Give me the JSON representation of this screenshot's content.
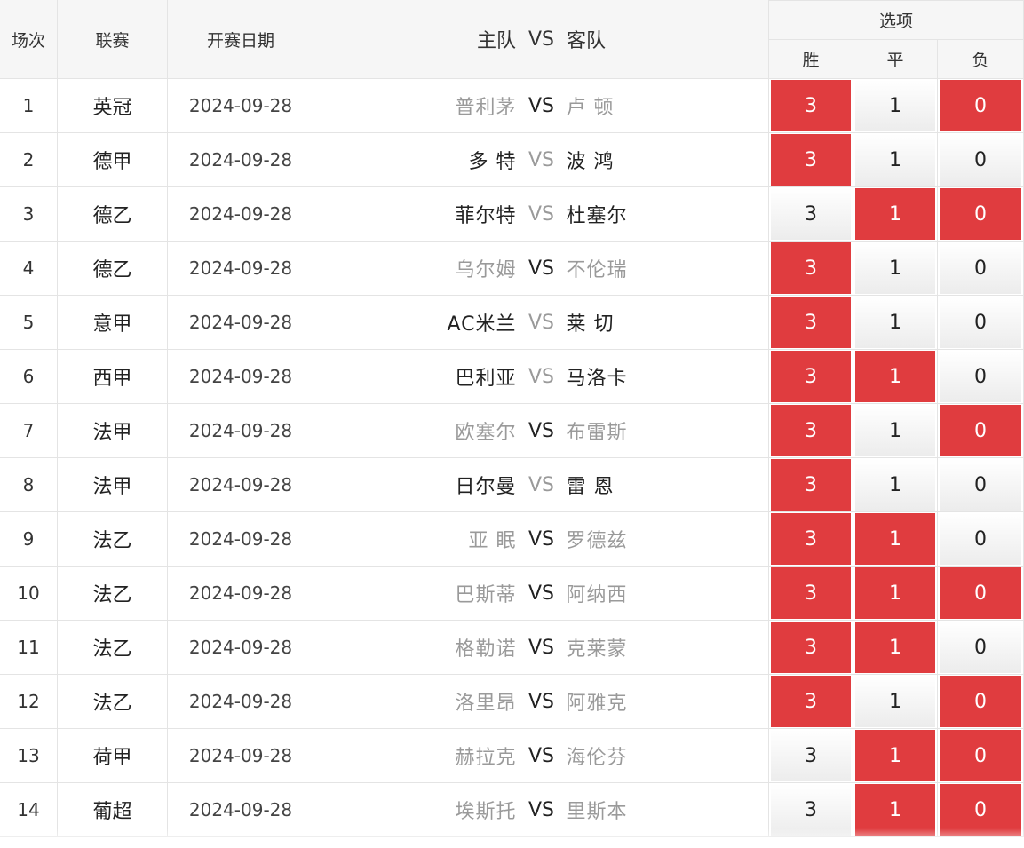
{
  "header": {
    "no": "场次",
    "league": "联赛",
    "date": "开赛日期",
    "home": "主队",
    "vs": "VS",
    "away": "客队",
    "options": "选项",
    "win": "胜",
    "draw": "平",
    "lose": "负"
  },
  "colors": {
    "accent": "#e03c3f",
    "dim_text": "#9a9a9a"
  },
  "rows": [
    {
      "no": "1",
      "league": "英冠",
      "date": "2024-09-28",
      "home": "普利茅",
      "away": "卢 顿",
      "vs": "VS",
      "win": "3",
      "draw": "1",
      "lose": "0"
    },
    {
      "no": "2",
      "league": "德甲",
      "date": "2024-09-28",
      "home": "多 特",
      "away": "波 鸿",
      "vs": "VS",
      "win": "3",
      "draw": "1",
      "lose": "0"
    },
    {
      "no": "3",
      "league": "德乙",
      "date": "2024-09-28",
      "home": "菲尔特",
      "away": "杜塞尔",
      "vs": "VS",
      "win": "3",
      "draw": "1",
      "lose": "0"
    },
    {
      "no": "4",
      "league": "德乙",
      "date": "2024-09-28",
      "home": "乌尔姆",
      "away": "不伦瑞",
      "vs": "VS",
      "win": "3",
      "draw": "1",
      "lose": "0"
    },
    {
      "no": "5",
      "league": "意甲",
      "date": "2024-09-28",
      "home": "AC米兰",
      "away": "莱 切",
      "vs": "VS",
      "win": "3",
      "draw": "1",
      "lose": "0"
    },
    {
      "no": "6",
      "league": "西甲",
      "date": "2024-09-28",
      "home": "巴利亚",
      "away": "马洛卡",
      "vs": "VS",
      "win": "3",
      "draw": "1",
      "lose": "0"
    },
    {
      "no": "7",
      "league": "法甲",
      "date": "2024-09-28",
      "home": "欧塞尔",
      "away": "布雷斯",
      "vs": "VS",
      "win": "3",
      "draw": "1",
      "lose": "0"
    },
    {
      "no": "8",
      "league": "法甲",
      "date": "2024-09-28",
      "home": "日尔曼",
      "away": "雷 恩",
      "vs": "VS",
      "win": "3",
      "draw": "1",
      "lose": "0"
    },
    {
      "no": "9",
      "league": "法乙",
      "date": "2024-09-28",
      "home": "亚 眠",
      "away": "罗德兹",
      "vs": "VS",
      "win": "3",
      "draw": "1",
      "lose": "0"
    },
    {
      "no": "10",
      "league": "法乙",
      "date": "2024-09-28",
      "home": "巴斯蒂",
      "away": "阿纳西",
      "vs": "VS",
      "win": "3",
      "draw": "1",
      "lose": "0"
    },
    {
      "no": "11",
      "league": "法乙",
      "date": "2024-09-28",
      "home": "格勒诺",
      "away": "克莱蒙",
      "vs": "VS",
      "win": "3",
      "draw": "1",
      "lose": "0"
    },
    {
      "no": "12",
      "league": "法乙",
      "date": "2024-09-28",
      "home": "洛里昂",
      "away": "阿雅克",
      "vs": "VS",
      "win": "3",
      "draw": "1",
      "lose": "0"
    },
    {
      "no": "13",
      "league": "荷甲",
      "date": "2024-09-28",
      "home": "赫拉克",
      "away": "海伦芬",
      "vs": "VS",
      "win": "3",
      "draw": "1",
      "lose": "0"
    },
    {
      "no": "14",
      "league": "葡超",
      "date": "2024-09-28",
      "home": "埃斯托",
      "away": "里斯本",
      "vs": "VS",
      "win": "3",
      "draw": "1",
      "lose": "0"
    }
  ],
  "selections": [
    {
      "win": true,
      "draw": false,
      "lose": true,
      "home_dim": true,
      "vs_dim": false,
      "away_dim": true
    },
    {
      "win": true,
      "draw": false,
      "lose": false,
      "home_dim": false,
      "vs_dim": true,
      "away_dim": false
    },
    {
      "win": false,
      "draw": true,
      "lose": true,
      "home_dim": false,
      "vs_dim": true,
      "away_dim": false
    },
    {
      "win": true,
      "draw": false,
      "lose": false,
      "home_dim": true,
      "vs_dim": false,
      "away_dim": true
    },
    {
      "win": true,
      "draw": false,
      "lose": false,
      "home_dim": false,
      "vs_dim": true,
      "away_dim": false
    },
    {
      "win": true,
      "draw": true,
      "lose": false,
      "home_dim": false,
      "vs_dim": true,
      "away_dim": false
    },
    {
      "win": true,
      "draw": false,
      "lose": true,
      "home_dim": true,
      "vs_dim": false,
      "away_dim": true
    },
    {
      "win": true,
      "draw": false,
      "lose": false,
      "home_dim": false,
      "vs_dim": true,
      "away_dim": false
    },
    {
      "win": true,
      "draw": true,
      "lose": false,
      "home_dim": true,
      "vs_dim": false,
      "away_dim": true
    },
    {
      "win": true,
      "draw": true,
      "lose": true,
      "home_dim": true,
      "vs_dim": false,
      "away_dim": true
    },
    {
      "win": true,
      "draw": true,
      "lose": false,
      "home_dim": true,
      "vs_dim": false,
      "away_dim": true
    },
    {
      "win": true,
      "draw": false,
      "lose": true,
      "home_dim": true,
      "vs_dim": false,
      "away_dim": true
    },
    {
      "win": false,
      "draw": true,
      "lose": true,
      "home_dim": true,
      "vs_dim": false,
      "away_dim": true
    },
    {
      "win": false,
      "draw": true,
      "lose": true,
      "home_dim": true,
      "vs_dim": false,
      "away_dim": true
    }
  ]
}
